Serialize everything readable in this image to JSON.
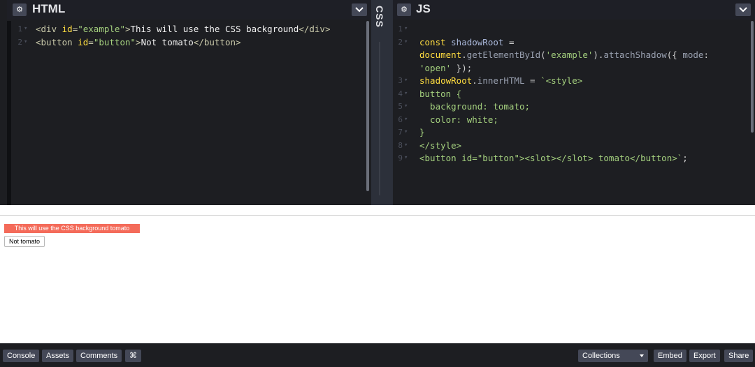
{
  "html_panel": {
    "title": "HTML",
    "gear_glyph": "⚙",
    "lines": [
      {
        "num": "1",
        "parts": [
          {
            "cls": "tag",
            "t": "<div "
          },
          {
            "cls": "attr",
            "t": "id"
          },
          {
            "cls": "tag",
            "t": "="
          },
          {
            "cls": "str",
            "t": "\"example\""
          },
          {
            "cls": "tag",
            "t": ">"
          },
          {
            "cls": "txt",
            "t": "This will use the CSS background"
          },
          {
            "cls": "tag",
            "t": "</div>"
          }
        ]
      },
      {
        "num": "2",
        "parts": [
          {
            "cls": "tag",
            "t": "<button "
          },
          {
            "cls": "attr",
            "t": "id"
          },
          {
            "cls": "tag",
            "t": "="
          },
          {
            "cls": "str",
            "t": "\"button\""
          },
          {
            "cls": "tag",
            "t": ">"
          },
          {
            "cls": "txt",
            "t": "Not tomato"
          },
          {
            "cls": "tag",
            "t": "</button>"
          }
        ]
      }
    ]
  },
  "css_label": "CSS",
  "js_panel": {
    "title": "JS",
    "gear_glyph": "⚙",
    "lines": [
      {
        "num": "1",
        "parts": []
      },
      {
        "num": "2",
        "parts": [
          {
            "cls": "kw",
            "t": "const "
          },
          {
            "cls": "fn",
            "t": "shadowRoot"
          },
          {
            "cls": "punc",
            "t": " ="
          }
        ]
      },
      {
        "num": "",
        "parts": [
          {
            "cls": "kw",
            "t": "document"
          },
          {
            "cls": "punc",
            "t": "."
          },
          {
            "cls": "prop",
            "t": "getElementById"
          },
          {
            "cls": "punc",
            "t": "("
          },
          {
            "cls": "str",
            "t": "'example'"
          },
          {
            "cls": "punc",
            "t": ")."
          },
          {
            "cls": "prop",
            "t": "attachShadow"
          },
          {
            "cls": "punc",
            "t": "({ "
          },
          {
            "cls": "prop",
            "t": "mode"
          },
          {
            "cls": "punc",
            "t": ":"
          }
        ]
      },
      {
        "num": "",
        "parts": [
          {
            "cls": "str",
            "t": "'open'"
          },
          {
            "cls": "punc",
            "t": " });"
          }
        ]
      },
      {
        "num": "3",
        "parts": [
          {
            "cls": "kw",
            "t": "shadowRoot"
          },
          {
            "cls": "punc",
            "t": "."
          },
          {
            "cls": "prop",
            "t": "innerHTML"
          },
          {
            "cls": "punc",
            "t": " = "
          },
          {
            "cls": "str",
            "t": "`<style>"
          }
        ]
      },
      {
        "num": "4",
        "parts": [
          {
            "cls": "str",
            "t": "button {"
          }
        ]
      },
      {
        "num": "5",
        "parts": [
          {
            "cls": "str",
            "t": "  background: tomato;"
          }
        ]
      },
      {
        "num": "6",
        "parts": [
          {
            "cls": "str",
            "t": "  color: white;"
          }
        ]
      },
      {
        "num": "7",
        "parts": [
          {
            "cls": "str",
            "t": "}"
          }
        ]
      },
      {
        "num": "8",
        "parts": [
          {
            "cls": "str",
            "t": "</style>"
          }
        ]
      },
      {
        "num": "9",
        "parts": [
          {
            "cls": "str",
            "t": "<button id=\"button\"><slot></slot> tomato</button>`"
          },
          {
            "cls": "punc",
            "t": ";"
          }
        ]
      }
    ]
  },
  "preview": {
    "tomato_text": "This will use the CSS background tomato",
    "button_text": "Not tomato"
  },
  "footer": {
    "console": "Console",
    "assets": "Assets",
    "comments": "Comments",
    "shortcut": "⌘",
    "collections": "Collections",
    "embed": "Embed",
    "export": "Export",
    "share": "Share"
  },
  "colors": {
    "tomato": "#f46b5a",
    "editor_bg": "#1d1e22",
    "button_bg": "#444857"
  }
}
